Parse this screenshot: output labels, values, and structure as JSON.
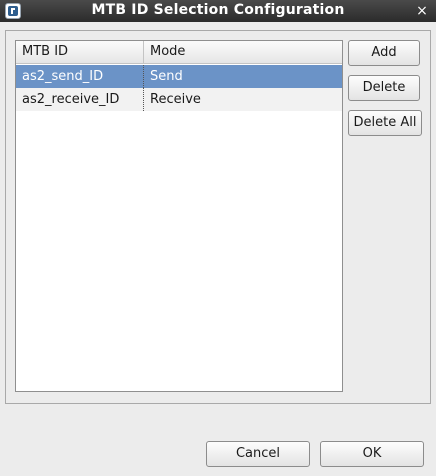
{
  "window": {
    "title": "MTB ID Selection Configuration",
    "app_icon": "app-logo-icon",
    "close_icon": "close-icon",
    "close_glyph": "×"
  },
  "table": {
    "columns": [
      "MTB ID",
      "Mode"
    ],
    "rows": [
      {
        "mtb_id": "as2_send_ID",
        "mode": "Send",
        "selected": true
      },
      {
        "mtb_id": "as2_receive_ID",
        "mode": "Receive",
        "selected": false
      }
    ],
    "selection_color": "#6b93c7"
  },
  "side_buttons": {
    "add": "Add",
    "delete": "Delete",
    "delete_all": "Delete All"
  },
  "dialog_buttons": {
    "cancel": "Cancel",
    "ok": "OK"
  }
}
